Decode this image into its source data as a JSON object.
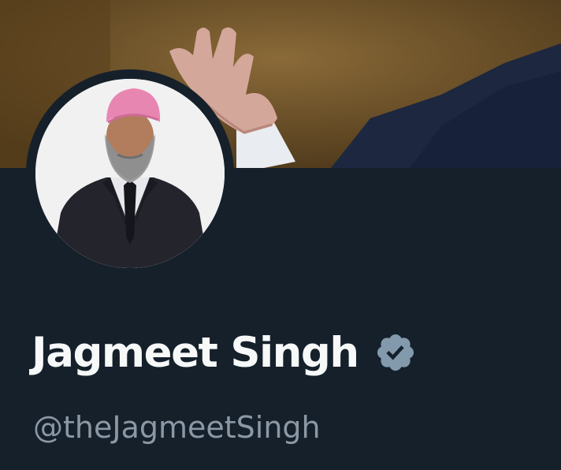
{
  "profile": {
    "display_name": "Jagmeet Singh",
    "handle": "@theJagmeetSingh",
    "verified": true,
    "verified_icon": "verified-badge-icon",
    "banner_image": "banner-photo",
    "avatar_image": "profile-avatar-photo"
  },
  "colors": {
    "background": "#15202b",
    "name_text": "#f7f9f9",
    "handle_text": "#8b98a5",
    "verified_badge": "#829aab"
  }
}
